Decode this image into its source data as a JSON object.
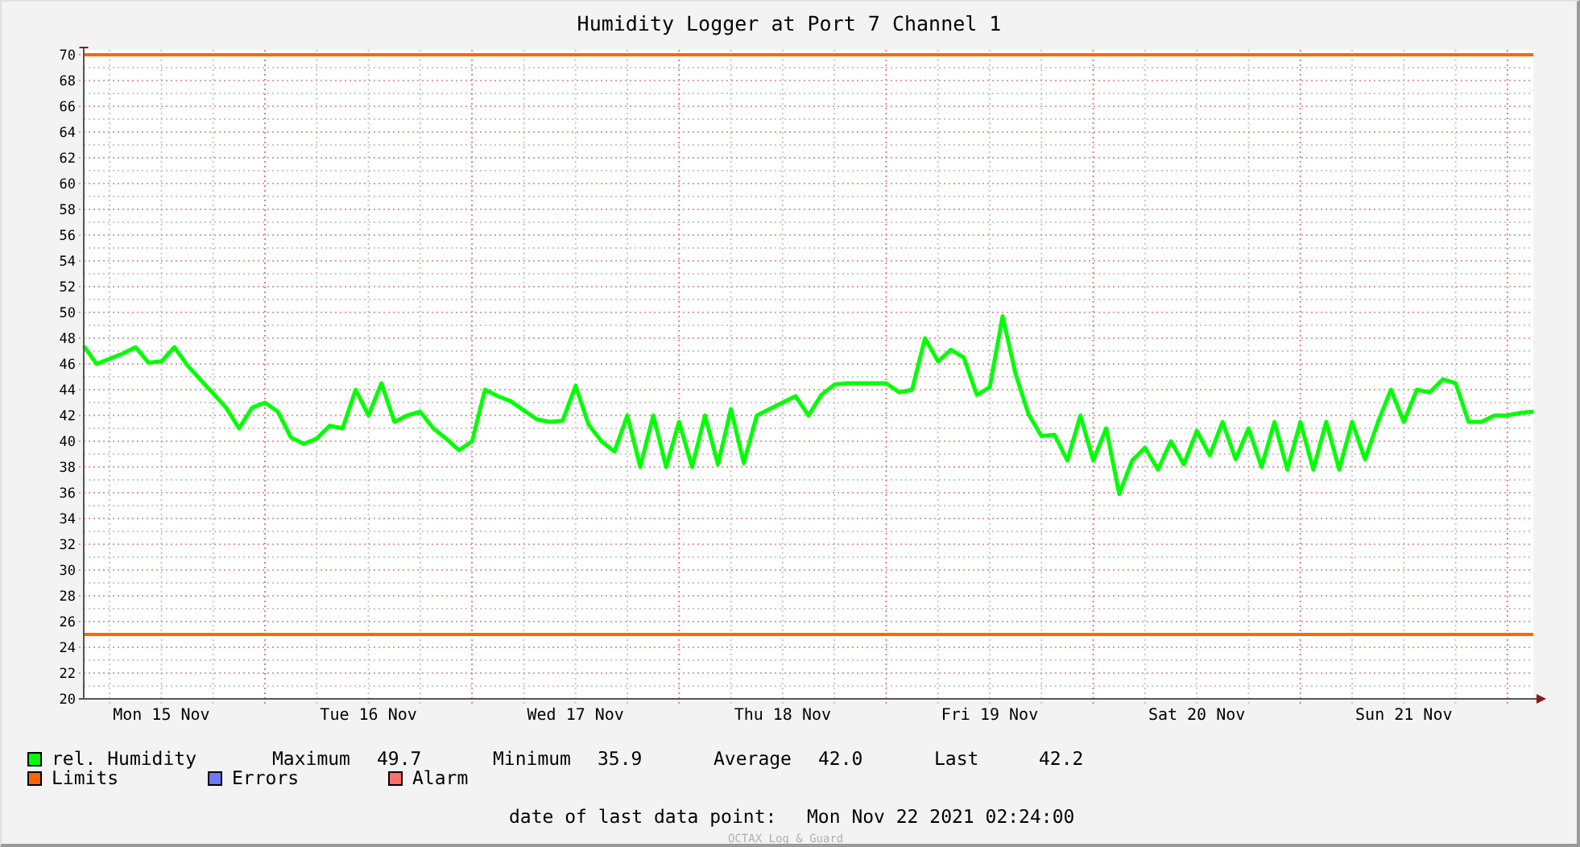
{
  "chart": {
    "title": "Humidity Logger at Port 7 Channel 1",
    "chart_data": {
      "type": "line",
      "categories": [
        null,
        null,
        null,
        null,
        null,
        null,
        "Mon 15 Nov",
        null,
        null,
        null,
        null,
        null,
        null,
        null,
        null,
        null,
        null,
        null,
        null,
        null,
        null,
        null,
        "Tue 16 Nov",
        null,
        null,
        null,
        null,
        null,
        null,
        null,
        null,
        null,
        null,
        null,
        null,
        null,
        null,
        null,
        "Wed 17 Nov",
        null,
        null,
        null,
        null,
        null,
        null,
        null,
        null,
        null,
        null,
        null,
        null,
        null,
        null,
        null,
        "Thu 18 Nov",
        null,
        null,
        null,
        null,
        null,
        null,
        null,
        null,
        null,
        null,
        null,
        null,
        null,
        null,
        null,
        "Fri 19 Nov",
        null,
        null,
        null,
        null,
        null,
        null,
        null,
        null,
        null,
        null,
        null,
        null,
        null,
        null,
        null,
        "Sat 20 Nov",
        null,
        null,
        null,
        null,
        null,
        null,
        null,
        null,
        null,
        null,
        null,
        null,
        null,
        null,
        null,
        "Sun 21 Nov",
        null,
        null,
        null,
        null,
        null,
        null,
        null,
        null,
        null,
        null
      ],
      "series": [
        {
          "name": "rel. Humidity",
          "color": "#00ff00",
          "values": [
            47.4,
            46,
            46.4,
            46.8,
            47.3,
            46.1,
            46.2,
            47.3,
            45.9,
            44.8,
            43.7,
            42.6,
            41,
            42.6,
            43,
            42.3,
            40.3,
            39.8,
            40.2,
            41.2,
            41,
            44,
            42,
            44.5,
            41.5,
            42,
            42.3,
            41,
            40.2,
            39.3,
            40,
            44,
            43.5,
            43.1,
            42.4,
            41.7,
            41.5,
            41.6,
            44.3,
            41.3,
            40,
            39.2,
            42,
            38,
            42,
            38,
            41.5,
            38,
            42,
            38.2,
            42.5,
            38.3,
            42,
            42.5,
            43,
            43.5,
            42,
            43.6,
            44.4,
            44.5,
            44.5,
            44.5,
            44.5,
            43.8,
            44,
            48,
            46.2,
            47.1,
            46.5,
            43.6,
            44.2,
            49.7,
            45.2,
            42.1,
            40.4,
            40.5,
            38.5,
            42,
            38.5,
            41,
            35.9,
            38.5,
            39.5,
            37.8,
            40,
            38.2,
            40.8,
            38.9,
            41.5,
            38.6,
            41,
            38,
            41.5,
            37.8,
            41.5,
            37.8,
            41.5,
            37.8,
            41.5,
            38.6,
            41.5,
            44,
            41.5,
            44,
            43.8,
            44.8,
            44.5,
            41.5,
            41.5,
            42,
            42,
            42.2,
            42.3
          ]
        }
      ],
      "ylim": [
        20,
        70
      ],
      "yticks": [
        20,
        22,
        24,
        26,
        28,
        30,
        32,
        34,
        36,
        38,
        40,
        42,
        44,
        46,
        48,
        50,
        52,
        54,
        56,
        58,
        60,
        62,
        64,
        66,
        68,
        70
      ],
      "grid": true,
      "ref_lines": [
        {
          "axis": "y",
          "value": 70,
          "color": "#ff6600"
        },
        {
          "axis": "y",
          "value": 25,
          "color": "#ff6600"
        }
      ]
    }
  },
  "legend": [
    {
      "label": "Limits",
      "color": "#ff6600"
    },
    {
      "label": "Errors",
      "color": "#6e78ff"
    },
    {
      "label": "Alarm",
      "color": "#ff6e6e"
    }
  ],
  "stats": [
    {
      "label": "Maximum",
      "value": "49.7"
    },
    {
      "label": "Minimum",
      "value": "35.9"
    },
    {
      "label": "Average",
      "value": "42.0"
    },
    {
      "label": "Last",
      "value": "42.2"
    }
  ],
  "last_data_point": {
    "label": "date of last data point:",
    "value": "Mon Nov 22 2021 02:24:00"
  },
  "credit": "OCTAX Log & Guard"
}
